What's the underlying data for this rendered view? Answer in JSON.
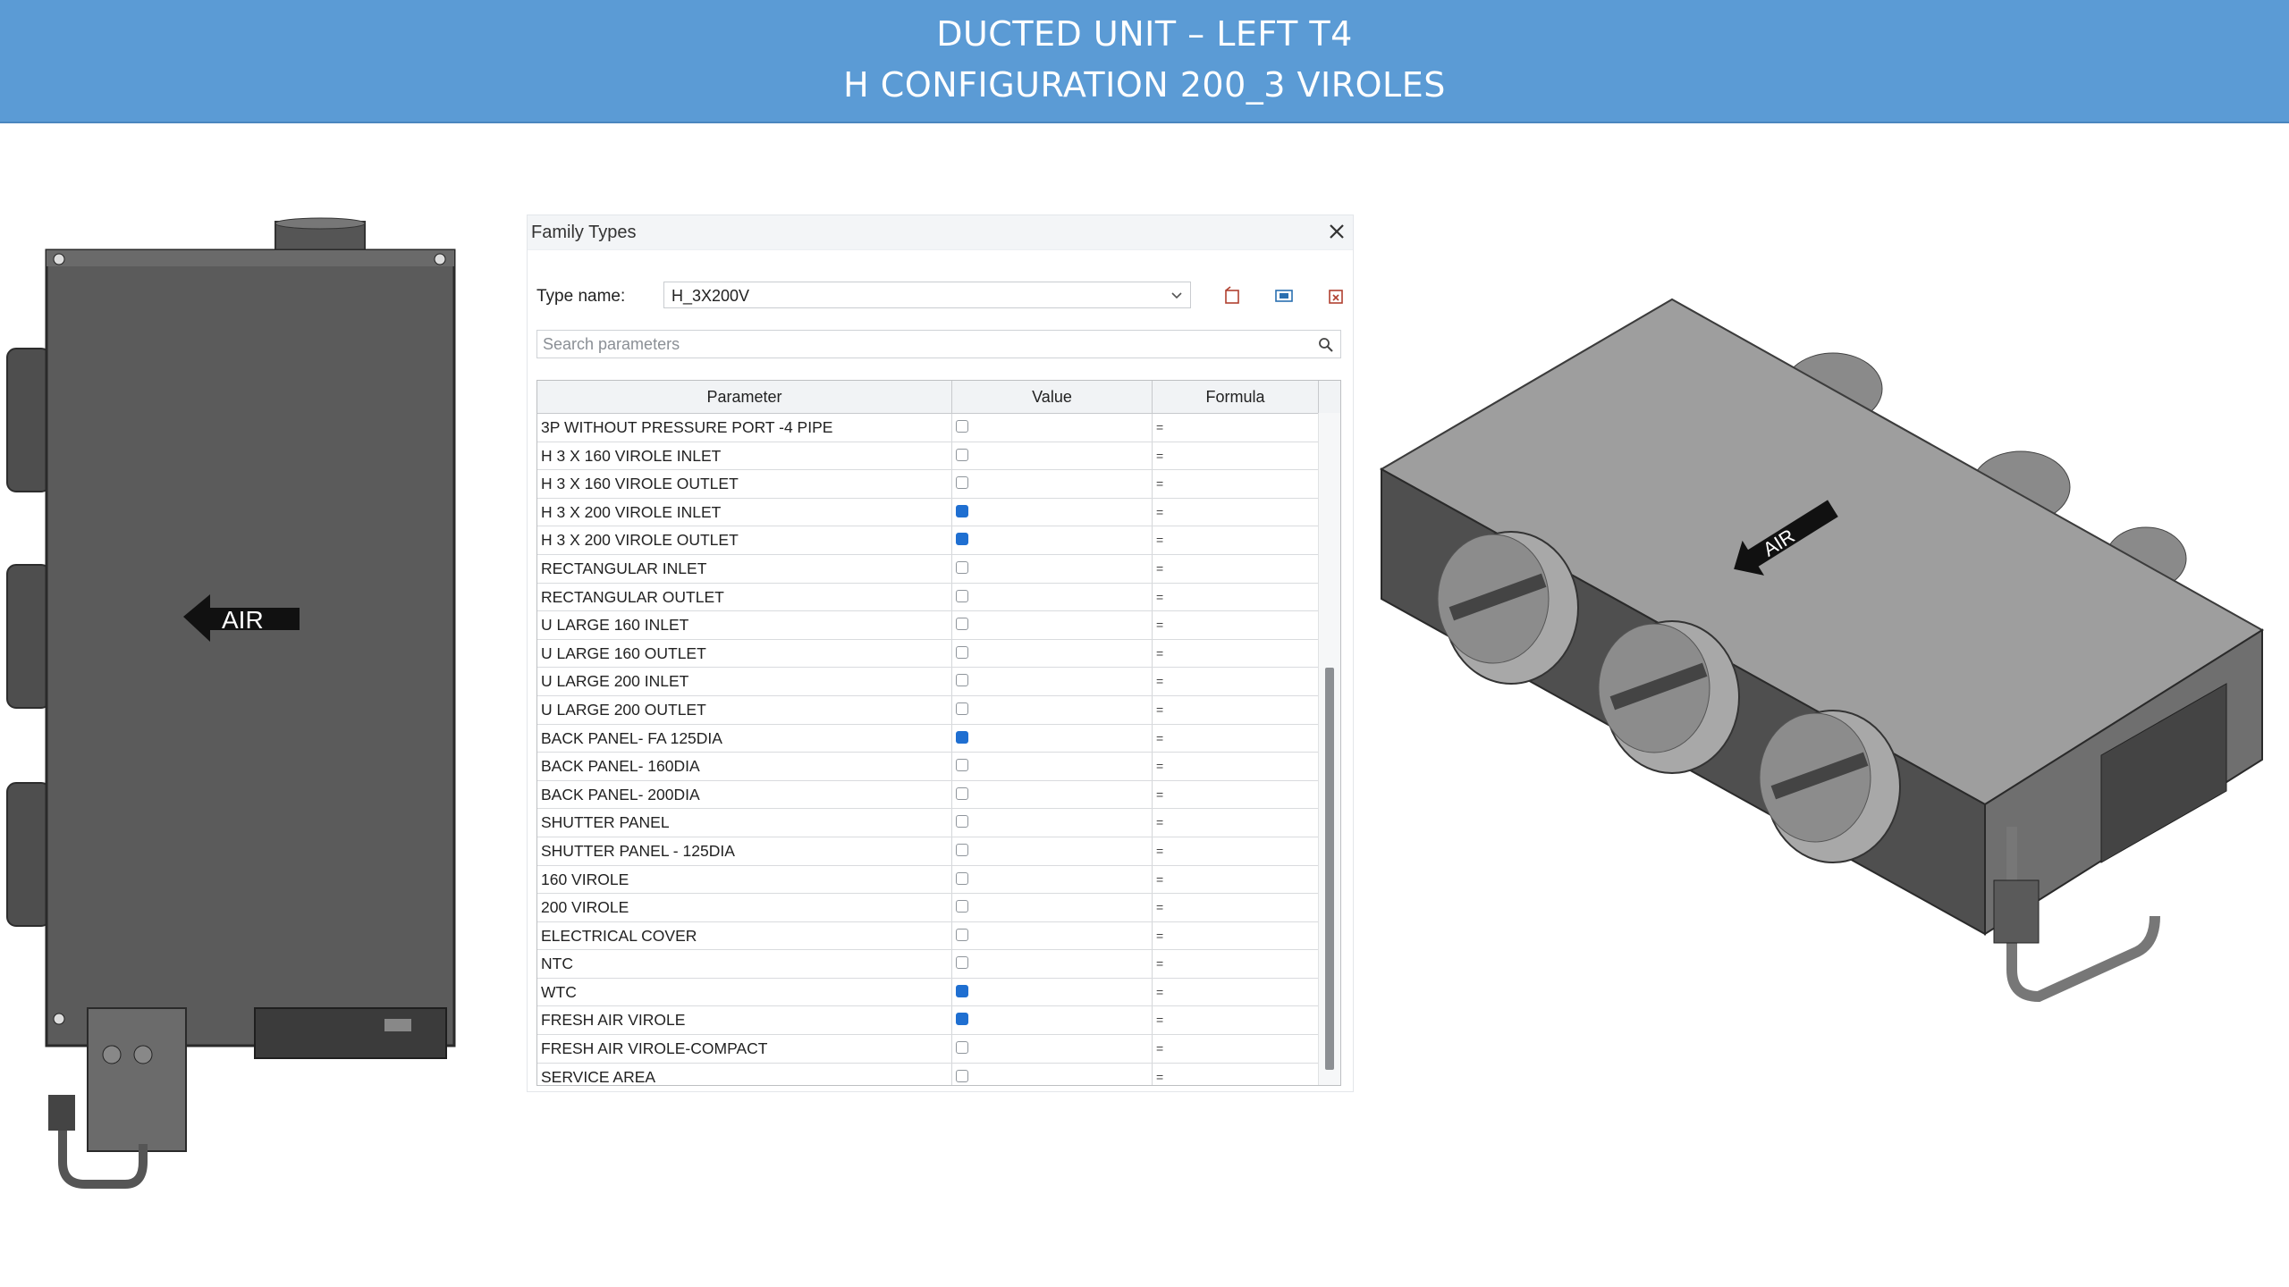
{
  "header": {
    "title_line1": "DUCTED UNIT – LEFT T4",
    "title_line2": "H CONFIGURATION 200_3  VIROLES"
  },
  "colors": {
    "header_bg": "#5b9bd5",
    "unit_body": "#5b5b5b",
    "checkbox_checked": "#1f6fd1"
  },
  "drawings": {
    "top_view_label": "AIR",
    "iso_view_label": "AIR"
  },
  "dialog": {
    "title": "Family Types",
    "close_icon": "close-icon",
    "type_label": "Type name:",
    "type_value": "H_3X200V",
    "tool_icons": [
      "new-type-icon",
      "rename-type-icon",
      "delete-type-icon"
    ],
    "search_placeholder": "Search parameters",
    "columns": {
      "parameter": "Parameter",
      "value": "Value",
      "formula": "Formula"
    },
    "rows": [
      {
        "name": "3P WITHOUT PRESSURE PORT -4  PIPE",
        "checked": false
      },
      {
        "name": "H  3 X 160 VIROLE INLET",
        "checked": false
      },
      {
        "name": "H  3 X 160 VIROLE OUTLET",
        "checked": false
      },
      {
        "name": "H  3 X 200 VIROLE INLET",
        "checked": true
      },
      {
        "name": "H  3 X 200 VIROLE OUTLET",
        "checked": true
      },
      {
        "name": "RECTANGULAR INLET",
        "checked": false
      },
      {
        "name": "RECTANGULAR OUTLET",
        "checked": false
      },
      {
        "name": "U LARGE 160 INLET",
        "checked": false
      },
      {
        "name": "U LARGE 160 OUTLET",
        "checked": false
      },
      {
        "name": "U LARGE 200 INLET",
        "checked": false
      },
      {
        "name": "U LARGE 200 OUTLET",
        "checked": false
      },
      {
        "name": "BACK PANEL- FA 125DIA",
        "checked": true
      },
      {
        "name": "BACK PANEL- 160DIA",
        "checked": false
      },
      {
        "name": "BACK PANEL- 200DIA",
        "checked": false
      },
      {
        "name": "SHUTTER PANEL",
        "checked": false
      },
      {
        "name": "SHUTTER PANEL - 125DIA",
        "checked": false
      },
      {
        "name": "160 VIROLE",
        "checked": false
      },
      {
        "name": "200 VIROLE",
        "checked": false
      },
      {
        "name": "ELECTRICAL COVER",
        "checked": false
      },
      {
        "name": "NTC",
        "checked": false
      },
      {
        "name": "WTC",
        "checked": true
      },
      {
        "name": "FRESH AIR VIROLE",
        "checked": true
      },
      {
        "name": "FRESH AIR VIROLE-COMPACT",
        "checked": false
      },
      {
        "name": "SERVICE AREA",
        "checked": false
      }
    ],
    "formula_mark": "="
  }
}
